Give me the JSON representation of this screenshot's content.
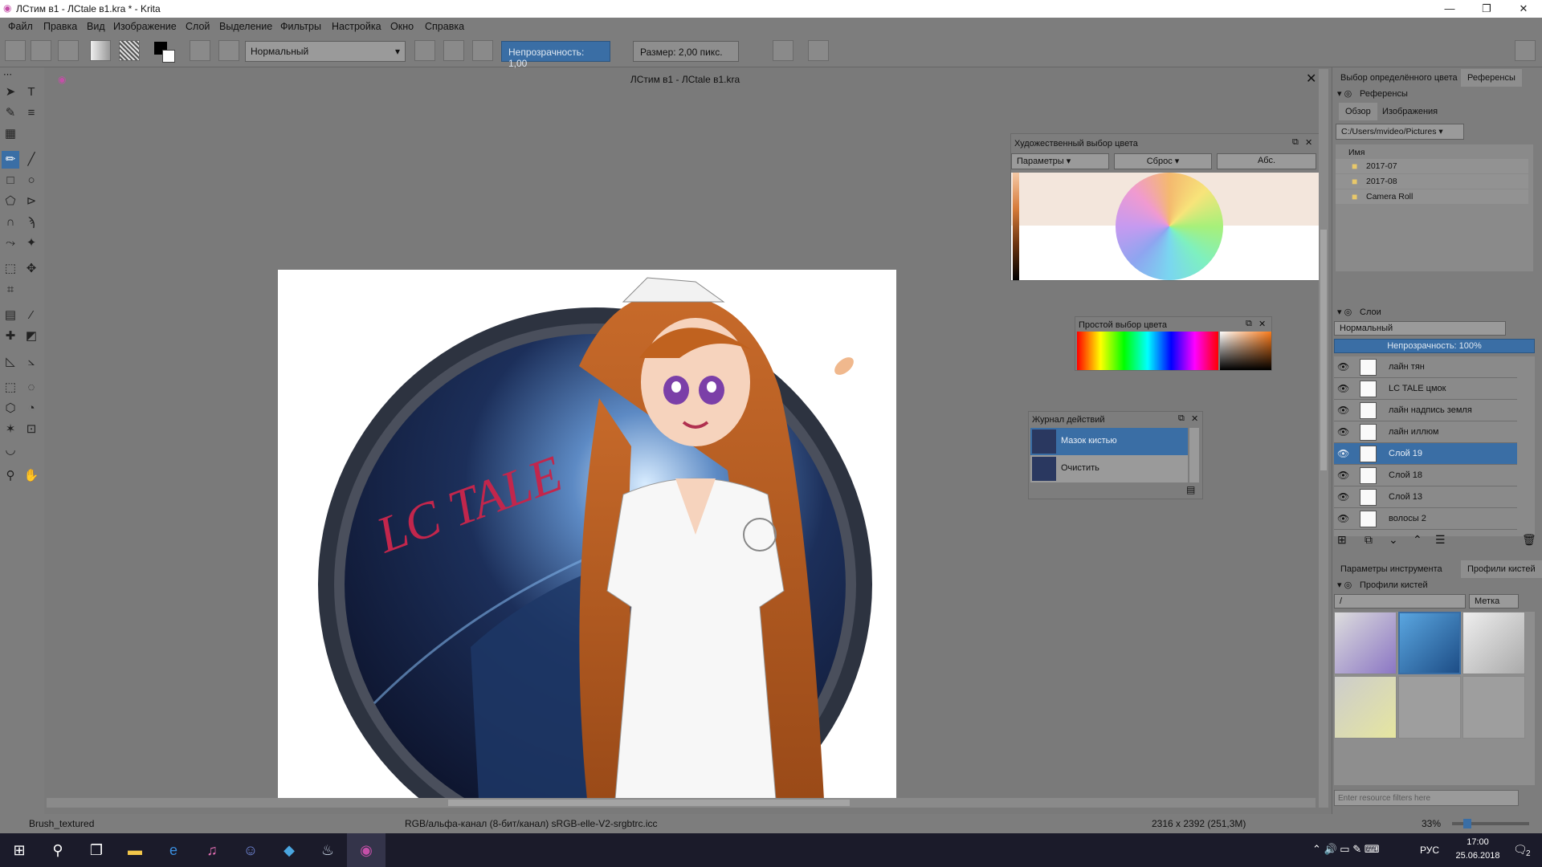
{
  "window": {
    "title": "ЛСтим в1 - ЛСtale в1.kra * - Krita",
    "controls": [
      "—",
      "❐",
      "✕"
    ]
  },
  "menu": [
    "Файл",
    "Правка",
    "Вид",
    "Изображение",
    "Слой",
    "Выделение",
    "Фильтры",
    "Настройка",
    "Окно",
    "Справка"
  ],
  "toolbar": {
    "blend_mode": "Нормальный",
    "opacity_label": "Непрозрачность:  1,00",
    "size_label": "Размер:  2,00 пикс."
  },
  "document": {
    "tab_title": "ЛСтим в1 - ЛСtale в1.kra",
    "artwork_text": "LC TALE"
  },
  "artistic_color": {
    "title": "Художественный выбор цвета",
    "params": "Параметры",
    "reset": "Сброс",
    "abs": "Абс."
  },
  "simple_color": {
    "title": "Простой выбор цвета"
  },
  "history": {
    "title": "Журнал действий",
    "items": [
      "Мазок кистью",
      "Очистить"
    ]
  },
  "right": {
    "top_tabs": [
      "Выбор определённого цвета",
      "Референсы"
    ],
    "refs_title": "Референсы",
    "ref_tabs": [
      "Обзор",
      "Изображения"
    ],
    "path": "C:/Users/mvideo/Pictures",
    "col_name": "Имя",
    "folders": [
      "2017-07",
      "2017-08",
      "Camera Roll"
    ],
    "layers_title": "Слои",
    "layers_mode": "Нормальный",
    "layers_opacity": "Непрозрачность:  100%",
    "layers": [
      "лайн тян",
      "LC TALE цмок",
      "лайн надпись земля",
      "лайн иллюм",
      "Слой 19",
      "Слой 18",
      "Слой 13",
      "волосы 2"
    ],
    "selected_layer": "Слой 19",
    "bottom_tabs": [
      "Параметры инструмента",
      "Профили кистей"
    ],
    "presets_title": "Профили кистей",
    "preset_filter": "/",
    "tag_label": "Метка",
    "filter_placeholder": "Enter resource filters here"
  },
  "status": {
    "brush": "Brush_textured",
    "color": "RGB/альфа-канал (8-бит/канал)  sRGB-elle-V2-srgbtrc.icc",
    "size": "2316 x 2392 (251,3M)",
    "zoom": "33%"
  },
  "taskbar": {
    "lang": "РУС",
    "time": "17:00",
    "date": "25.06.2018",
    "notif": "2"
  }
}
